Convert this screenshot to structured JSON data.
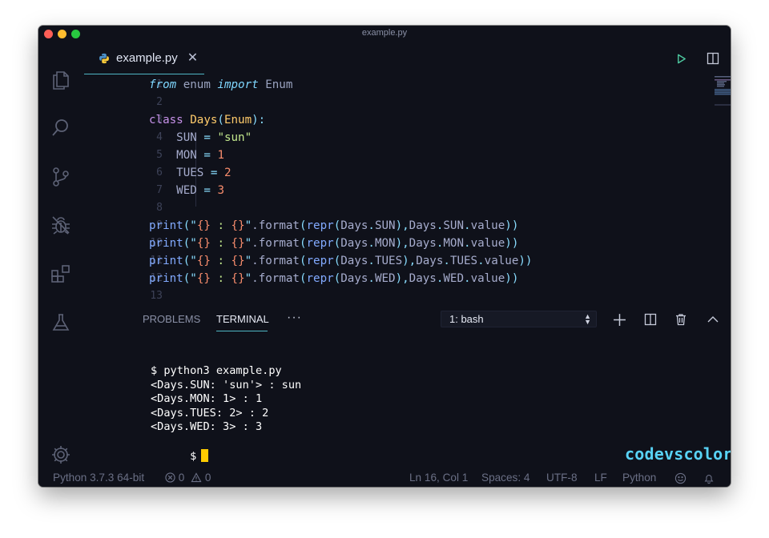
{
  "window": {
    "title": "example.py"
  },
  "activity_bar": {
    "items": [
      {
        "name": "explorer-icon"
      },
      {
        "name": "search-icon"
      },
      {
        "name": "source-control-icon"
      },
      {
        "name": "debug-icon"
      },
      {
        "name": "extensions-icon"
      },
      {
        "name": "testing-flask-icon"
      }
    ],
    "bottom": {
      "name": "gear-icon"
    }
  },
  "tabs": [
    {
      "label": "example.py",
      "icon": "python-icon",
      "close": "✕"
    }
  ],
  "editor_actions": [
    "run-icon",
    "split-editor-icon",
    "more-actions-icon"
  ],
  "editor": {
    "lines": [
      {
        "n": "1",
        "tokens": [
          [
            "from",
            "k-italic"
          ],
          [
            " enum ",
            "k-plain"
          ],
          [
            "import",
            "k-italic"
          ],
          [
            " Enum",
            "k-plain"
          ]
        ]
      },
      {
        "n": "2",
        "tokens": []
      },
      {
        "n": "3",
        "tokens": [
          [
            "class ",
            "k-class"
          ],
          [
            "Days",
            "k-type"
          ],
          [
            "(",
            "k-paren"
          ],
          [
            "Enum",
            "k-type"
          ],
          [
            "):",
            "k-paren"
          ]
        ]
      },
      {
        "n": "4",
        "tokens": [
          [
            "    SUN ",
            "k-id"
          ],
          [
            "=",
            "k-op"
          ],
          [
            " ",
            "k-id"
          ],
          [
            "\"sun\"",
            "k-str"
          ]
        ]
      },
      {
        "n": "5",
        "tokens": [
          [
            "    MON ",
            "k-id"
          ],
          [
            "=",
            "k-op"
          ],
          [
            " ",
            "k-id"
          ],
          [
            "1",
            "k-num"
          ]
        ]
      },
      {
        "n": "6",
        "tokens": [
          [
            "    TUES ",
            "k-id"
          ],
          [
            "=",
            "k-op"
          ],
          [
            " ",
            "k-id"
          ],
          [
            "2",
            "k-num"
          ]
        ]
      },
      {
        "n": "7",
        "tokens": [
          [
            "    WED ",
            "k-id"
          ],
          [
            "=",
            "k-op"
          ],
          [
            " ",
            "k-id"
          ],
          [
            "3",
            "k-num"
          ]
        ]
      },
      {
        "n": "8",
        "tokens": []
      },
      {
        "n": "9",
        "tokens": [
          [
            "print",
            "k-fn"
          ],
          [
            "(\"",
            "k-paren"
          ],
          [
            "{}",
            "k-brace"
          ],
          [
            " : ",
            "k-str"
          ],
          [
            "{}",
            "k-brace"
          ],
          [
            "\"",
            "k-paren"
          ],
          [
            ".format",
            "k-id"
          ],
          [
            "(",
            "k-paren"
          ],
          [
            "repr",
            "k-fn"
          ],
          [
            "(",
            "k-paren"
          ],
          [
            "Days",
            "k-id"
          ],
          [
            ".",
            "k-paren"
          ],
          [
            "SUN",
            "k-id"
          ],
          [
            "),",
            "k-paren"
          ],
          [
            "Days",
            "k-id"
          ],
          [
            ".",
            "k-paren"
          ],
          [
            "SUN",
            "k-id"
          ],
          [
            ".",
            "k-paren"
          ],
          [
            "value",
            "k-id"
          ],
          [
            "))",
            "k-paren"
          ]
        ]
      },
      {
        "n": "10",
        "tokens": [
          [
            "print",
            "k-fn"
          ],
          [
            "(\"",
            "k-paren"
          ],
          [
            "{}",
            "k-brace"
          ],
          [
            " : ",
            "k-str"
          ],
          [
            "{}",
            "k-brace"
          ],
          [
            "\"",
            "k-paren"
          ],
          [
            ".format",
            "k-id"
          ],
          [
            "(",
            "k-paren"
          ],
          [
            "repr",
            "k-fn"
          ],
          [
            "(",
            "k-paren"
          ],
          [
            "Days",
            "k-id"
          ],
          [
            ".",
            "k-paren"
          ],
          [
            "MON",
            "k-id"
          ],
          [
            "),",
            "k-paren"
          ],
          [
            "Days",
            "k-id"
          ],
          [
            ".",
            "k-paren"
          ],
          [
            "MON",
            "k-id"
          ],
          [
            ".",
            "k-paren"
          ],
          [
            "value",
            "k-id"
          ],
          [
            "))",
            "k-paren"
          ]
        ]
      },
      {
        "n": "11",
        "tokens": [
          [
            "print",
            "k-fn"
          ],
          [
            "(\"",
            "k-paren"
          ],
          [
            "{}",
            "k-brace"
          ],
          [
            " : ",
            "k-str"
          ],
          [
            "{}",
            "k-brace"
          ],
          [
            "\"",
            "k-paren"
          ],
          [
            ".format",
            "k-id"
          ],
          [
            "(",
            "k-paren"
          ],
          [
            "repr",
            "k-fn"
          ],
          [
            "(",
            "k-paren"
          ],
          [
            "Days",
            "k-id"
          ],
          [
            ".",
            "k-paren"
          ],
          [
            "TUES",
            "k-id"
          ],
          [
            "),",
            "k-paren"
          ],
          [
            "Days",
            "k-id"
          ],
          [
            ".",
            "k-paren"
          ],
          [
            "TUES",
            "k-id"
          ],
          [
            ".",
            "k-paren"
          ],
          [
            "value",
            "k-id"
          ],
          [
            "))",
            "k-paren"
          ]
        ]
      },
      {
        "n": "12",
        "tokens": [
          [
            "print",
            "k-fn"
          ],
          [
            "(\"",
            "k-paren"
          ],
          [
            "{}",
            "k-brace"
          ],
          [
            " : ",
            "k-str"
          ],
          [
            "{}",
            "k-brace"
          ],
          [
            "\"",
            "k-paren"
          ],
          [
            ".format",
            "k-id"
          ],
          [
            "(",
            "k-paren"
          ],
          [
            "repr",
            "k-fn"
          ],
          [
            "(",
            "k-paren"
          ],
          [
            "Days",
            "k-id"
          ],
          [
            ".",
            "k-paren"
          ],
          [
            "WED",
            "k-id"
          ],
          [
            "),",
            "k-paren"
          ],
          [
            "Days",
            "k-id"
          ],
          [
            ".",
            "k-paren"
          ],
          [
            "WED",
            "k-id"
          ],
          [
            ".",
            "k-paren"
          ],
          [
            "value",
            "k-id"
          ],
          [
            "))",
            "k-paren"
          ]
        ]
      },
      {
        "n": "13",
        "tokens": []
      }
    ]
  },
  "panel": {
    "tabs": [
      {
        "label": "PROBLEMS",
        "active": false
      },
      {
        "label": "TERMINAL",
        "active": true
      }
    ],
    "more": "···",
    "shell_select": "1: bash",
    "actions": [
      "new-terminal-icon",
      "split-terminal-icon",
      "kill-terminal-icon",
      "maximize-panel-icon",
      "close-panel-icon"
    ],
    "terminal_lines": [
      "$ python3 example.py",
      "<Days.SUN: 'sun'> : sun",
      "<Days.MON: 1> : 1",
      "<Days.TUES: 2> : 2",
      "<Days.WED: 3> : 3"
    ],
    "prompt": "$",
    "watermark": "codevscolor.com"
  },
  "status_bar": {
    "interpreter": "Python 3.7.3 64-bit",
    "errors": "0",
    "warnings": "0",
    "position": "Ln 16, Col 1",
    "spaces": "Spaces: 4",
    "encoding": "UTF-8",
    "eol": "LF",
    "language": "Python"
  },
  "colors": {
    "background": "#0f111a",
    "accent": "#4fb6c4",
    "cursor": "#ffcc00"
  }
}
